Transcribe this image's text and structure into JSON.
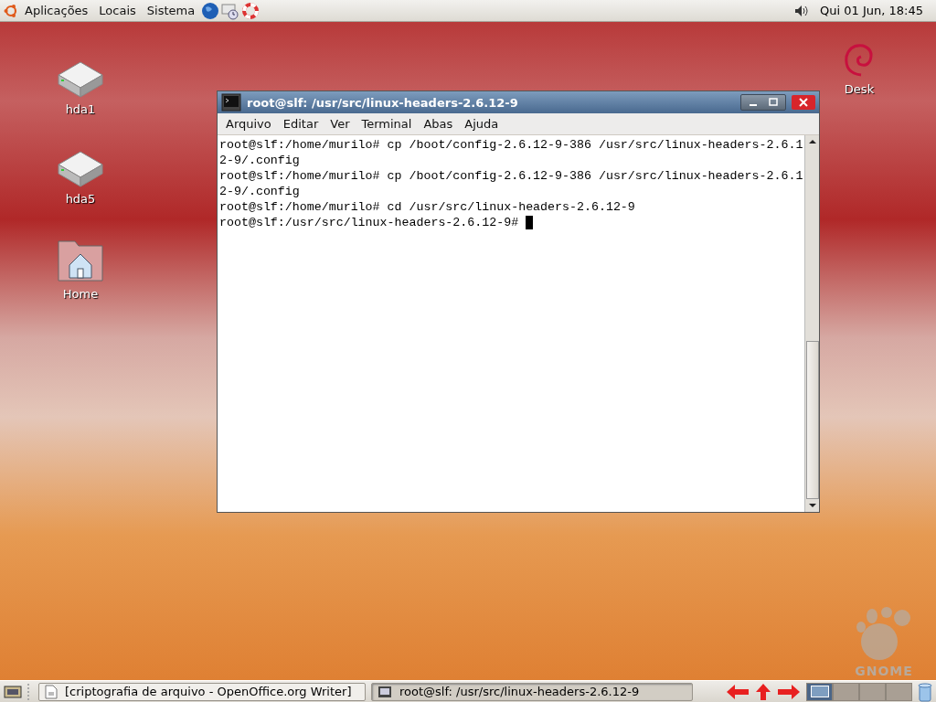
{
  "top_panel": {
    "menus": [
      "Aplicações",
      "Locais",
      "Sistema"
    ],
    "clock": "Qui 01 Jun, 18:45"
  },
  "desktop_icons": [
    {
      "kind": "drive",
      "label": "hda1"
    },
    {
      "kind": "drive",
      "label": "hda5"
    },
    {
      "kind": "home",
      "label": "Home"
    },
    {
      "kind": "debian",
      "label": "Desk"
    }
  ],
  "wallpaper": {
    "logo_text": "GNOME"
  },
  "window": {
    "title": "root@slf: /usr/src/linux-headers-2.6.12-9",
    "menu": [
      "Arquivo",
      "Editar",
      "Ver",
      "Terminal",
      "Abas",
      "Ajuda"
    ],
    "lines": [
      "root@slf:/home/murilo# cp /boot/config-2.6.12-9-386 /usr/src/linux-headers-2.6.1",
      "2-9/.config",
      "root@slf:/home/murilo# cp /boot/config-2.6.12-9-386 /usr/src/linux-headers-2.6.1",
      "2-9/.config",
      "root@slf:/home/murilo# cd /usr/src/linux-headers-2.6.12-9",
      "root@slf:/usr/src/linux-headers-2.6.12-9# "
    ]
  },
  "taskbar": {
    "tasks": [
      {
        "kind": "document",
        "label": "[criptografia de arquivo - OpenOffice.org Writer]",
        "selected": false
      },
      {
        "kind": "terminal",
        "label": "root@slf: /usr/src/linux-headers-2.6.12-9",
        "selected": true
      }
    ],
    "workspaces": [
      {
        "selected": true
      },
      {
        "selected": false
      },
      {
        "selected": false
      },
      {
        "selected": false
      }
    ]
  }
}
